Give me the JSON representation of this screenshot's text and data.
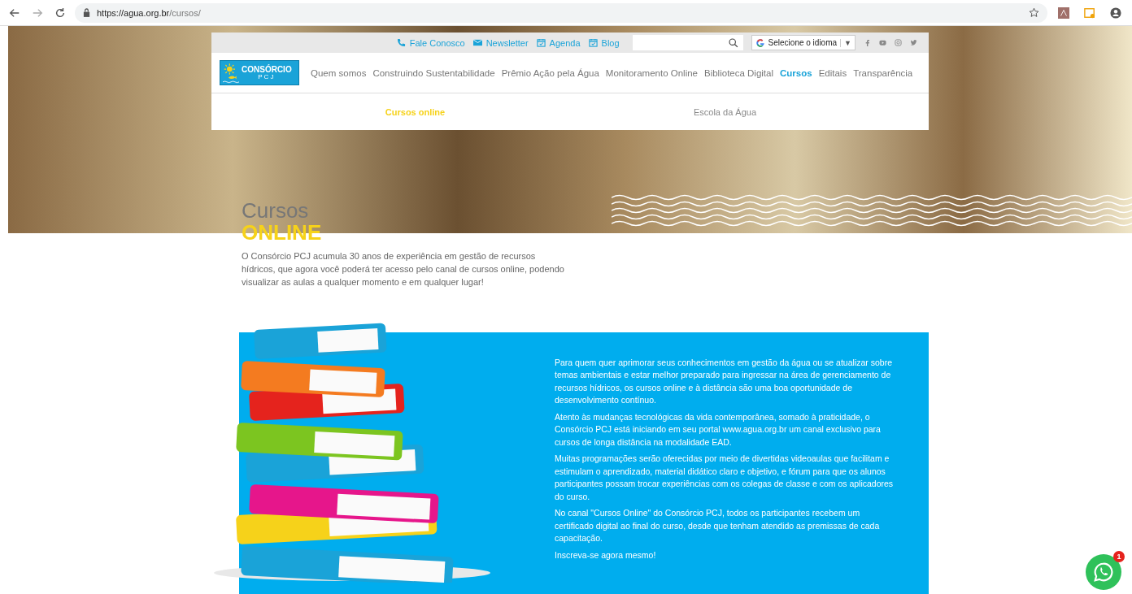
{
  "browser": {
    "url_host": "https://agua.org.br",
    "url_path": "/cursos/"
  },
  "top_links": [
    {
      "label": "Fale Conosco",
      "kind": "phone"
    },
    {
      "label": "Newsletter",
      "kind": "mail"
    },
    {
      "label": "Agenda",
      "kind": "calendar"
    },
    {
      "label": "Blog",
      "kind": "calendar"
    }
  ],
  "language_select": {
    "label": "Selecione o idioma",
    "caret": "▼"
  },
  "logo": {
    "name": "CONSÓRCIO",
    "sub": "PCJ"
  },
  "nav": [
    {
      "label": "Quem somos",
      "selected": false
    },
    {
      "label": "Construindo Sustentabilidade",
      "selected": false
    },
    {
      "label": "Prêmio Ação pela Água",
      "selected": false
    },
    {
      "label": "Monitoramento Online",
      "selected": false
    },
    {
      "label": "Biblioteca Digital",
      "selected": false
    },
    {
      "label": "Cursos",
      "selected": true
    },
    {
      "label": "Editais",
      "selected": false
    },
    {
      "label": "Transparência",
      "selected": false
    }
  ],
  "subnav": [
    {
      "label": "Cursos online",
      "selected": true
    },
    {
      "label": "Escola da Água",
      "selected": false
    }
  ],
  "heading": {
    "line1": "Cursos",
    "line2": "ONLINE"
  },
  "intro": "O Consórcio PCJ acumula 30 anos de experiência em gestão de recursos hídricos, que agora você poderá ter acesso pelo canal de cursos online, podendo visualizar as aulas a qualquer momento e em qualquer lugar!",
  "paragraphs": [
    "Para quem quer aprimorar seus conhecimentos em gestão da água ou se atualizar sobre temas ambientais e estar melhor preparado para ingressar na área de gerenciamento de recursos hídricos, os cursos online e à distância são uma boa oportunidade de desenvolvimento contínuo.",
    "Atento às mudanças tecnológicas da vida contemporânea, somado à praticidade, o Consórcio PCJ está iniciando em seu portal www.agua.org.br um canal exclusivo para cursos de longa distância na modalidade EAD.",
    "Muitas programações serão oferecidas por meio de divertidas videoaulas que facilitam e estimulam o aprendizado, material didático claro e objetivo, e fórum para que os alunos participantes possam trocar experiências com os colegas de classe e com os aplicadores do curso.",
    "No canal \"Cursos Online\" do Consórcio PCJ, todos os participantes recebem um certificado digital ao final do curso, desde que tenham atendido as premissas de cada capacitação.",
    "Inscreva-se agora mesmo!"
  ],
  "chat_badge": "1"
}
